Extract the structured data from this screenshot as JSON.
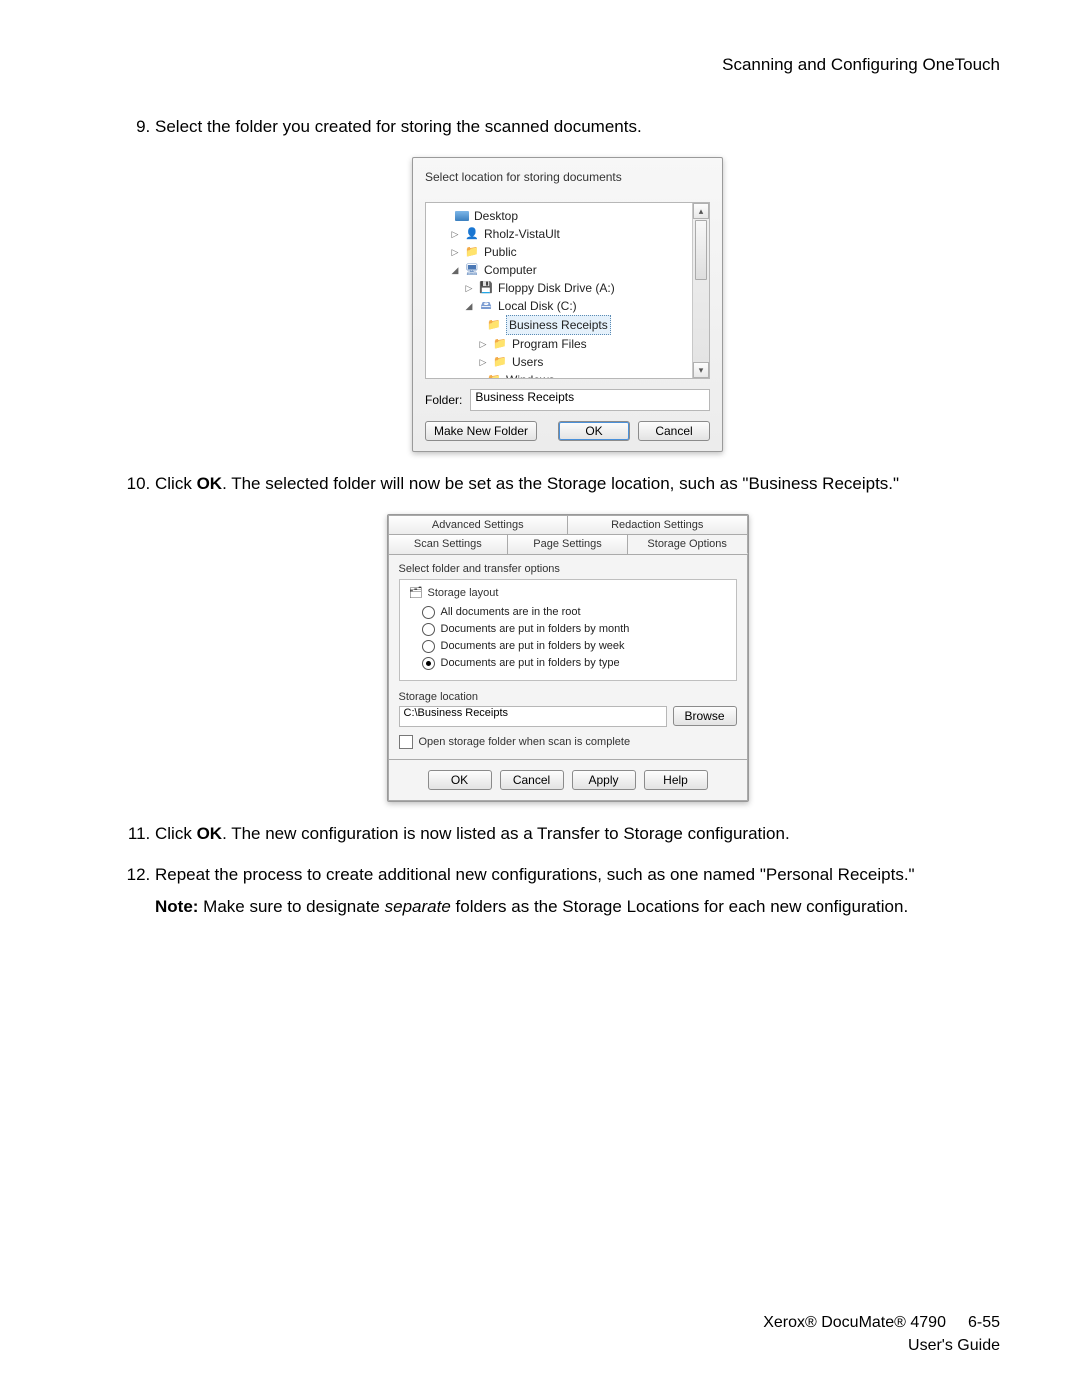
{
  "header": "Scanning and Configuring OneTouch",
  "steps": {
    "n9": "Select the folder you created for storing the scanned documents.",
    "n10_pre": "Click ",
    "n10_ok": "OK",
    "n10_post": ". The selected folder will now be set as the Storage location, such as \"Business Receipts.\"",
    "n11_pre": "Click ",
    "n11_ok": "OK",
    "n11_post": ". The new configuration is now listed as a Transfer to Storage configuration.",
    "n12": "Repeat the process to create additional new configurations, such as one named \"Personal Receipts.\"",
    "note_label": "Note:",
    "note_pre": " Make sure to designate ",
    "note_italic": "separate",
    "note_post": " folders as the Storage Locations for each new configuration."
  },
  "dlg1": {
    "title": "Select location for storing documents",
    "tree": {
      "desktop": "Desktop",
      "user": "Rholz-VistaUlt",
      "public": "Public",
      "computer": "Computer",
      "floppy": "Floppy Disk Drive (A:)",
      "localdisk": "Local Disk (C:)",
      "biz": "Business Receipts",
      "pfiles": "Program Files",
      "users": "Users",
      "windows": "Windows"
    },
    "folder_label": "Folder:",
    "folder_value": "Business Receipts",
    "make_new": "Make New Folder",
    "ok": "OK",
    "cancel": "Cancel"
  },
  "dlg2": {
    "tabs_top": {
      "adv": "Advanced Settings",
      "red": "Redaction Settings"
    },
    "tabs_bot": {
      "scan": "Scan Settings",
      "page": "Page Settings",
      "storage": "Storage Options"
    },
    "group_title": "Select folder and transfer options",
    "layout_title": "Storage layout",
    "radios": {
      "root": "All documents are in the root",
      "month": "Documents are put in folders by month",
      "week": "Documents are put in folders by week",
      "type": "Documents are put in folders by type"
    },
    "loc_label": "Storage location",
    "loc_value": "C:\\Business Receipts",
    "browse": "Browse",
    "chk": "Open storage folder when scan is complete",
    "ok": "OK",
    "cancel": "Cancel",
    "apply": "Apply",
    "help": "Help"
  },
  "footer": {
    "line1a": "Xerox® DocuMate® 4790",
    "pagenum": "6-55",
    "line2": "User's Guide"
  }
}
